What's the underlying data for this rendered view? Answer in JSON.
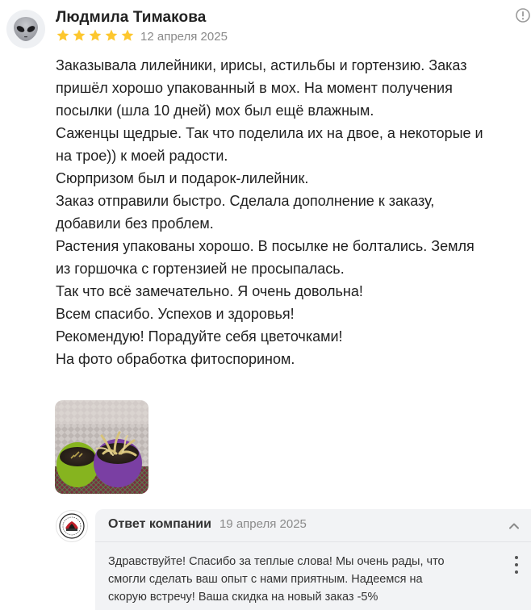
{
  "review": {
    "author": "Людмила Тимакова",
    "rating": 5,
    "date": "12 апреля 2025",
    "lines": [
      "Заказывала лилейники, ирисы, астильбы и гортензию. Заказ",
      "пришёл хорошо упакованный в мох. На момент получения",
      "посылки (шла 10 дней) мох был ещё влажным.",
      "Саженцы щедрые. Так что поделила их на двое, а некоторые и",
      "на трое)) к моей радости.",
      "Сюрпризом был и подарок-лилейник.",
      "Заказ отправили быстро. Сделала дополнение к заказу,",
      "добавили без проблем.",
      "Растения упакованы хорошо. В посылке не болтались. Земля",
      "из горшочка с гортензией не просыпалась.",
      "Так что всё замечательно. Я очень довольна!",
      "Всем спасибо. Успехов и здоровья!",
      "Рекомендую! Порадуйте себя цветочками!",
      "На фото обработка фитоспорином."
    ]
  },
  "reply": {
    "title": "Ответ компании",
    "date": "19 апреля 2025",
    "lines": [
      "Здравствуйте! Спасибо за теплые слова! Мы очень рады, что",
      "смогли сделать ваш опыт с нами приятным. Надеемся на",
      "скорую встречу! Ваша скидка на новый заказ -5%"
    ]
  },
  "colors": {
    "star": "#fdc72e",
    "muted": "#8a8a8a",
    "reply_bg": "#f2f3f5"
  },
  "icons": {
    "avatar": "alien-face-icon",
    "report": "exclamation-circle-icon",
    "star": "star-icon",
    "collapse": "chevron-up-icon",
    "menu": "vertical-dots-icon",
    "company_logo": "company-logo-icon"
  }
}
